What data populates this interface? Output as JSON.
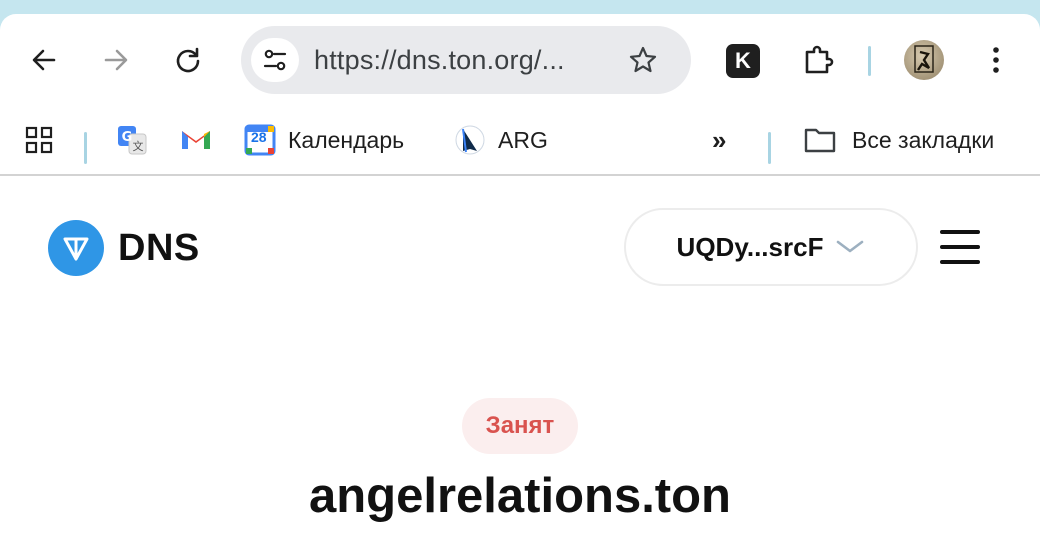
{
  "browser": {
    "url": "https://dns.ton.org/...",
    "extension_label": "K"
  },
  "bookmarks": [
    {
      "label": "",
      "icon": "translate-icon"
    },
    {
      "label": "",
      "icon": "gmail-icon"
    },
    {
      "label": "Календарь",
      "icon": "calendar-icon",
      "icon_text": "28"
    },
    {
      "label": "ARG",
      "icon": "arg-icon"
    }
  ],
  "bookmarks_more": "»",
  "all_bookmarks_label": "Все закладки",
  "page": {
    "logo_text": "DNS",
    "wallet_address": "UQDy...srcF",
    "status_badge": "Занят",
    "domain_name": "angelrelations.ton"
  },
  "colors": {
    "accent": "#2f96e6",
    "status_red": "#d9534f",
    "status_bg": "#fbeeee"
  }
}
